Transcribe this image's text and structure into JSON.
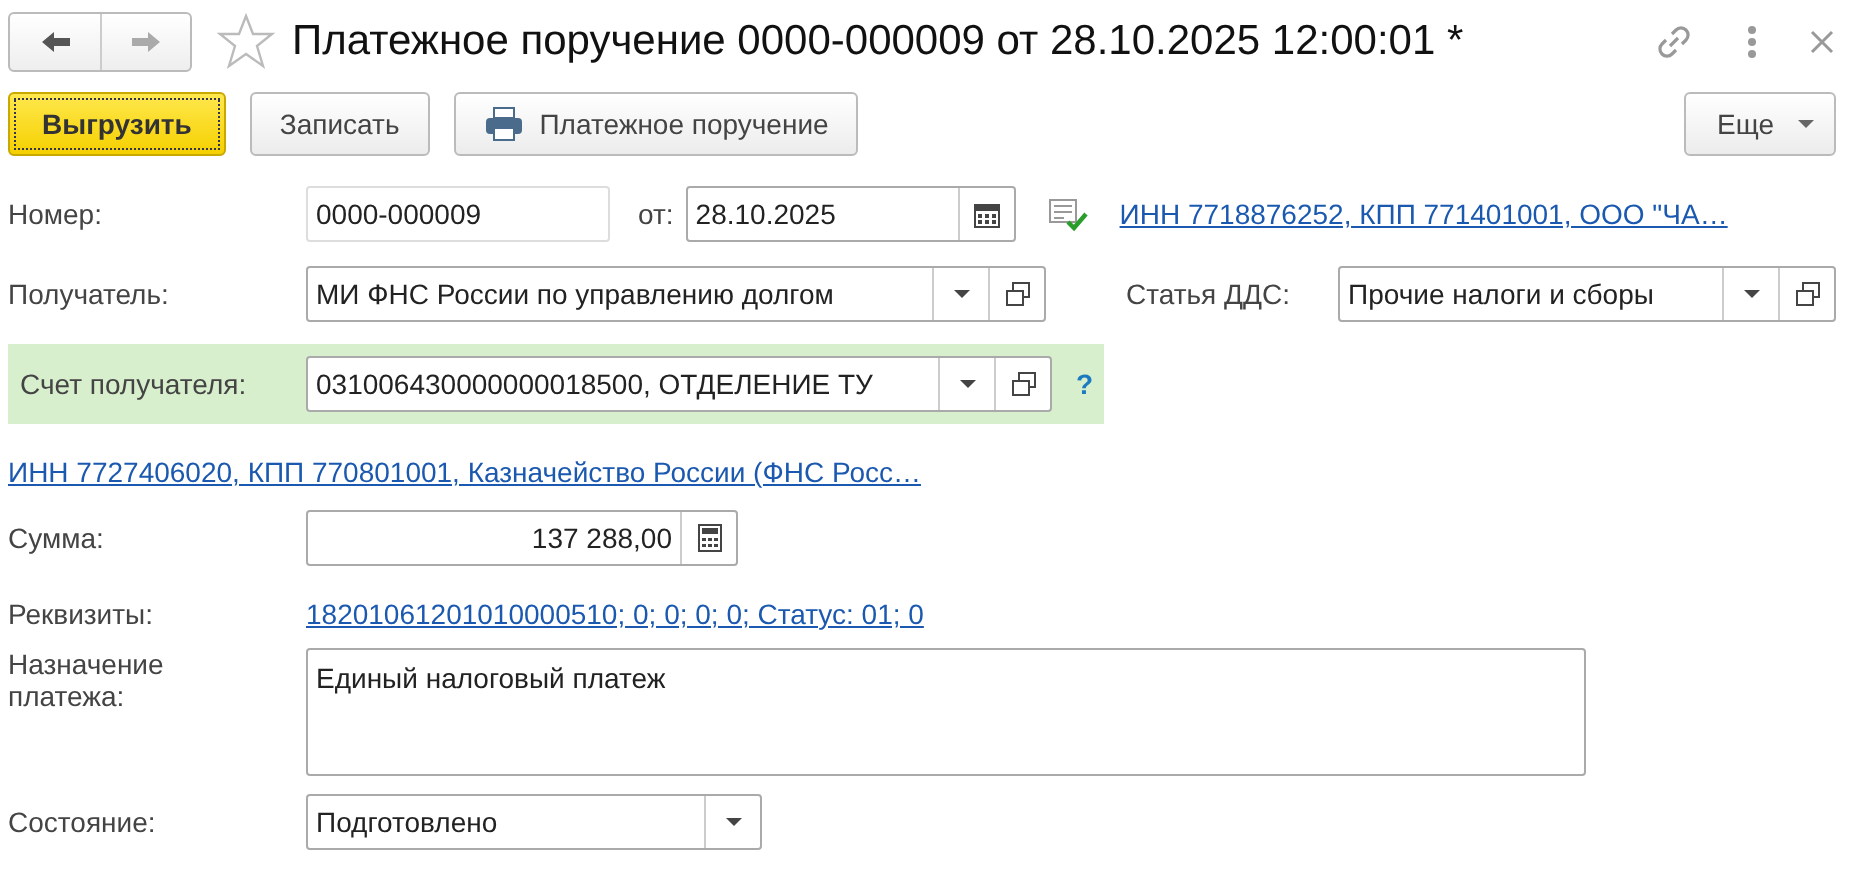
{
  "window": {
    "title": "Платежное поручение 0000-000009 от 28.10.2025 12:00:01 *"
  },
  "toolbar": {
    "buttons": [
      {
        "label": "Выгрузить",
        "kind": "primary"
      },
      {
        "label": "Записать",
        "kind": "plain"
      },
      {
        "label": "Платежное поручение",
        "kind": "print"
      }
    ],
    "more": "Еще"
  },
  "number": {
    "label": "Номер:",
    "value": "0000-000009"
  },
  "date": {
    "label": "от:",
    "value": "28.10.2025"
  },
  "organization_link": "ИНН 7718876252, КПП 771401001, ООО \"ЧА…",
  "recipient": {
    "label": "Получатель:",
    "value": "МИ ФНС России по управлению долгом"
  },
  "cash_flow_item": {
    "label": "Статья ДДС:",
    "value": "Прочие налоги и сборы"
  },
  "recipient_account": {
    "label": "Счет получателя:",
    "value": "031006430000000018500, ОТДЕЛЕНИЕ ТУ",
    "help": "?"
  },
  "recipient_link": "ИНН 7727406020, КПП 770801001, Казначейство России (ФНС Росс…",
  "amount": {
    "label": "Сумма:",
    "value": "137 288,00"
  },
  "details": {
    "label": "Реквизиты:",
    "value": "18201061201010000510; 0; 0; 0; 0; Статус: 01; 0"
  },
  "purpose": {
    "label": "Назначение платежа:",
    "value": "Единый налоговый платеж"
  },
  "status": {
    "label": "Состояние:",
    "value": "Подготовлено"
  }
}
